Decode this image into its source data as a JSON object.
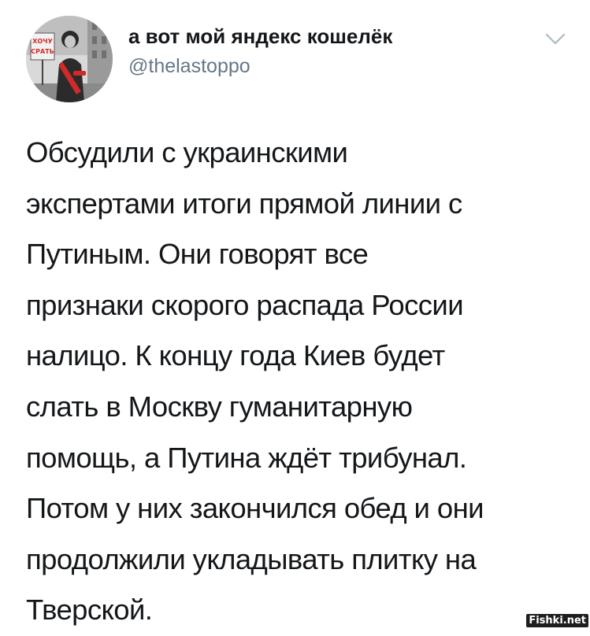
{
  "tweet": {
    "author": {
      "display_name": "а вот мой яндекс кошелёк",
      "handle": "@thelastoppo",
      "avatar_icon": "profile-photo-avatar",
      "avatar_sign_text": "ХОЧУ СРАТЬ"
    },
    "menu_icon": "chevron-down-icon",
    "text_lines": [
      "Обсудили с украинскими",
      "экспертами итоги прямой линии с",
      "Путиным. Они говорят все",
      "признаки скорого распада России",
      "налицо. К концу года Киев будет",
      "слать в Москву гуманитарную",
      "помощь, а Путина ждёт трибунал.",
      "Потом у них закончился обед и они",
      "продолжили укладывать плитку на",
      "Тверской."
    ]
  },
  "watermark": "Fishki.net",
  "colors": {
    "text": "#14171a",
    "secondary_text": "#657786",
    "chevron": "#aab8c2",
    "avatar_accent": "#d02a2a",
    "background": "#ffffff"
  }
}
